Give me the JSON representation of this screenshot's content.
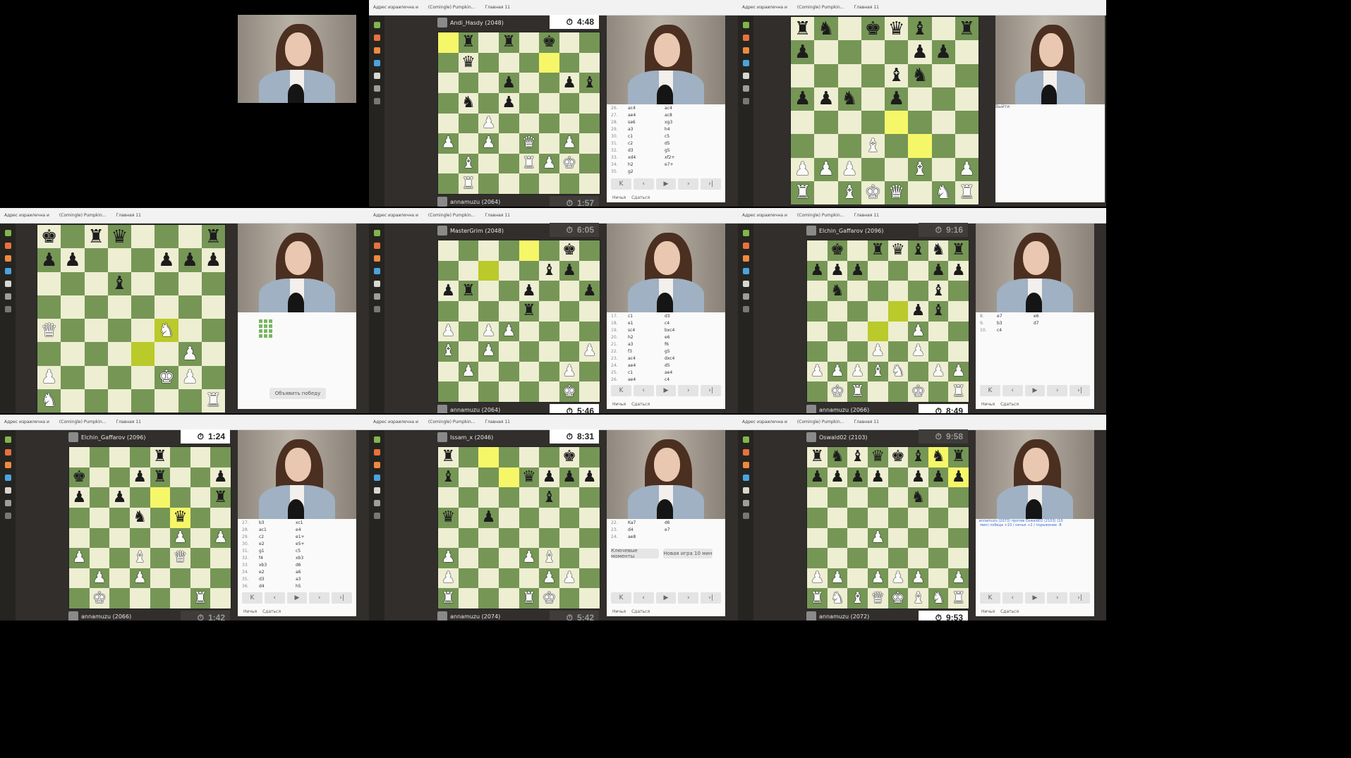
{
  "browser_tabs": [
    "Адрес израилечна и",
    "(Comingle) Pumpkin...",
    "Главная 11"
  ],
  "icons": {
    "piece_glyphs": {
      "K": "♚",
      "Q": "♛",
      "R": "♜",
      "B": "♝",
      "N": "♞",
      "P": "♟"
    },
    "sidebar": [
      "pawn-icon",
      "puzzle-icon",
      "learn-icon",
      "watch-icon",
      "news-icon",
      "social-icon",
      "more-icon"
    ],
    "controls": [
      "first-move-icon",
      "prev-move-icon",
      "play-icon",
      "next-move-icon",
      "last-move-icon"
    ]
  },
  "colors": {
    "light_square": "#eeeed2",
    "dark_square": "#769656",
    "highlight_light": "#f6f669",
    "highlight_dark": "#baca2b",
    "arrow": "#f2a51c"
  },
  "controls_labels": [
    "K",
    "‹",
    "▶",
    "›",
    "›|"
  ],
  "footer_labels": [
    "Ничья",
    "Сдаться"
  ],
  "tiles": [
    {
      "id": "t1",
      "kind": "black"
    },
    {
      "id": "t2",
      "kind": "game",
      "top_player": "Andi_Hasdy (2048)",
      "bottom_player": "annamuzu (2064)",
      "top_clock": "4:48",
      "bottom_clock": "1:57",
      "active": "top",
      "board": [
        " R R k",
        " Q     ",
        " ..P  PB",
        " N P   ",
        "  P    ",
        "P P Q P",
        " B  RPK ",
        " R"
      ],
      "moves": [
        [
          "26.",
          "ac4",
          "ac4"
        ],
        [
          "27.",
          "ae4",
          "ac8"
        ],
        [
          "28.",
          "sa6",
          "xg3"
        ],
        [
          "29.",
          "a3",
          "h4"
        ],
        [
          "30.",
          "c1",
          "c5"
        ],
        [
          "31.",
          "c2",
          "d5"
        ],
        [
          "32.",
          "d3",
          "g5"
        ],
        [
          "33.",
          "xd4",
          "xf2+"
        ],
        [
          "34.",
          "h2",
          "e7+"
        ],
        [
          "35.",
          "g2",
          ""
        ]
      ]
    },
    {
      "id": "t3",
      "kind": "game",
      "top_player": "",
      "bottom_player": "",
      "top_clock": "",
      "bottom_clock": "",
      "active": "none",
      "board": [
        "RN KQB R",
        "P    PP ",
        "    BN  ",
        "PPN P   ",
        "",
        "   B    ",
        "PPP  B P",
        "R BKQ NR"
      ],
      "moves": [],
      "panel_note": "Выйти"
    },
    {
      "id": "t4",
      "kind": "game",
      "top_player": "",
      "bottom_player": "",
      "top_clock": "",
      "bottom_clock": "",
      "active": "none",
      "board": [
        "K RQ   R",
        "PP   PPP",
        "   B    ",
        "        ",
        "Q    N  ",
        "      P ",
        "P    KP ",
        "N      R"
      ],
      "moves": [],
      "claim_label": "Объявить победу"
    },
    {
      "id": "t5",
      "kind": "game",
      "top_player": "MasterGrim (2048)",
      "bottom_player": "annamuzu (2064)",
      "top_clock": "6:05",
      "bottom_clock": "5:46",
      "active": "bottom",
      "board": [
        "      K ",
        "     BP ",
        "PR  P  P",
        "    R   ",
        "P PP    ",
        "B P    P",
        " P    P ",
        "      K "
      ],
      "moves": [
        [
          "17.",
          "c1",
          "d3"
        ],
        [
          "18.",
          "e1",
          "c4"
        ],
        [
          "19.",
          "sc4",
          "bxc4"
        ],
        [
          "20.",
          "h2",
          "e6"
        ],
        [
          "21.",
          "a3",
          "f6"
        ],
        [
          "22.",
          "f3",
          "g5"
        ],
        [
          "23.",
          "ac4",
          "dxc4"
        ],
        [
          "24.",
          "ae4",
          "d5"
        ],
        [
          "25.",
          "c1",
          "ae4"
        ],
        [
          "26.",
          "ae4",
          "c4"
        ]
      ]
    },
    {
      "id": "t6",
      "kind": "game",
      "top_player": "Elchin_Gaffarov (2096)",
      "bottom_player": "annamuzu (2066)",
      "top_clock": "9:16",
      "bottom_clock": "8:49",
      "active": "bottom",
      "board": [
        " K RQBNR",
        "PPP   PP",
        " N    B ",
        "     PB ",
        "     P  ",
        "   P P  ",
        "PPPBN PP",
        " KR  K R"
      ],
      "moves": [
        [
          "8.",
          "e7",
          "e6"
        ],
        [
          "9.",
          "b3",
          "d7"
        ],
        [
          "10.",
          "c4",
          ""
        ]
      ]
    },
    {
      "id": "t7",
      "kind": "game",
      "top_player": "Elchin_Gaffarov (2096)",
      "bottom_player": "annamuzu (2066)",
      "top_clock": "1:24",
      "bottom_clock": "1:42",
      "active": "top",
      "board": [
        "    R   ",
        "K  PR  P",
        "P P    R",
        "   N Q  ",
        "     P P",
        "P  B Q  ",
        " P P    ",
        " K    R "
      ],
      "moves": [
        [
          "27.",
          "b3",
          "xc1"
        ],
        [
          "28.",
          "ac1",
          "e4"
        ],
        [
          "29.",
          "c2",
          "e1+"
        ],
        [
          "30.",
          "e2",
          "e5+"
        ],
        [
          "31.",
          "g1",
          "c5"
        ],
        [
          "32.",
          "f4",
          "xb3"
        ],
        [
          "33.",
          "xb3",
          "d6"
        ],
        [
          "34.",
          "e2",
          "a6"
        ],
        [
          "35.",
          "d3",
          "a3"
        ],
        [
          "36.",
          "d4",
          "h5"
        ]
      ]
    },
    {
      "id": "t8",
      "kind": "game",
      "top_player": "Issam_x (2046)",
      "bottom_player": "annamuzu (2074)",
      "top_clock": "8:31",
      "bottom_clock": "5:42",
      "active": "top",
      "board": [
        "R     K ",
        "B   QPPP",
        "     B  ",
        "Q P     ",
        "       ",
        "P   PB  ",
        "P    PP ",
        "R   RK  "
      ],
      "moves": [
        [
          "22.",
          "Ka7",
          "d6"
        ],
        [
          "23.",
          "d4",
          "e7"
        ],
        [
          "24.",
          "ae8",
          ""
        ]
      ],
      "key_moments": "Ключевые моменты",
      "new_game": "Новая игра 10 мин"
    },
    {
      "id": "t9",
      "kind": "game",
      "top_player": "Oswald02 (2103)",
      "bottom_player": "annamuzu (2072)",
      "top_clock": "9:58",
      "bottom_clock": "9:53",
      "active": "bottom",
      "board": [
        "RNBQKBNR",
        "PPPP PPP",
        "     N  ",
        "      ",
        "   P    ",
        "        ",
        "PP PPP P",
        "RNBQKBNR"
      ],
      "moves": [],
      "match_info": "annamuzu (2073) против Oswald02 (2103) (10 мин) победа +10 / ничья +2 / поражение -8"
    }
  ]
}
